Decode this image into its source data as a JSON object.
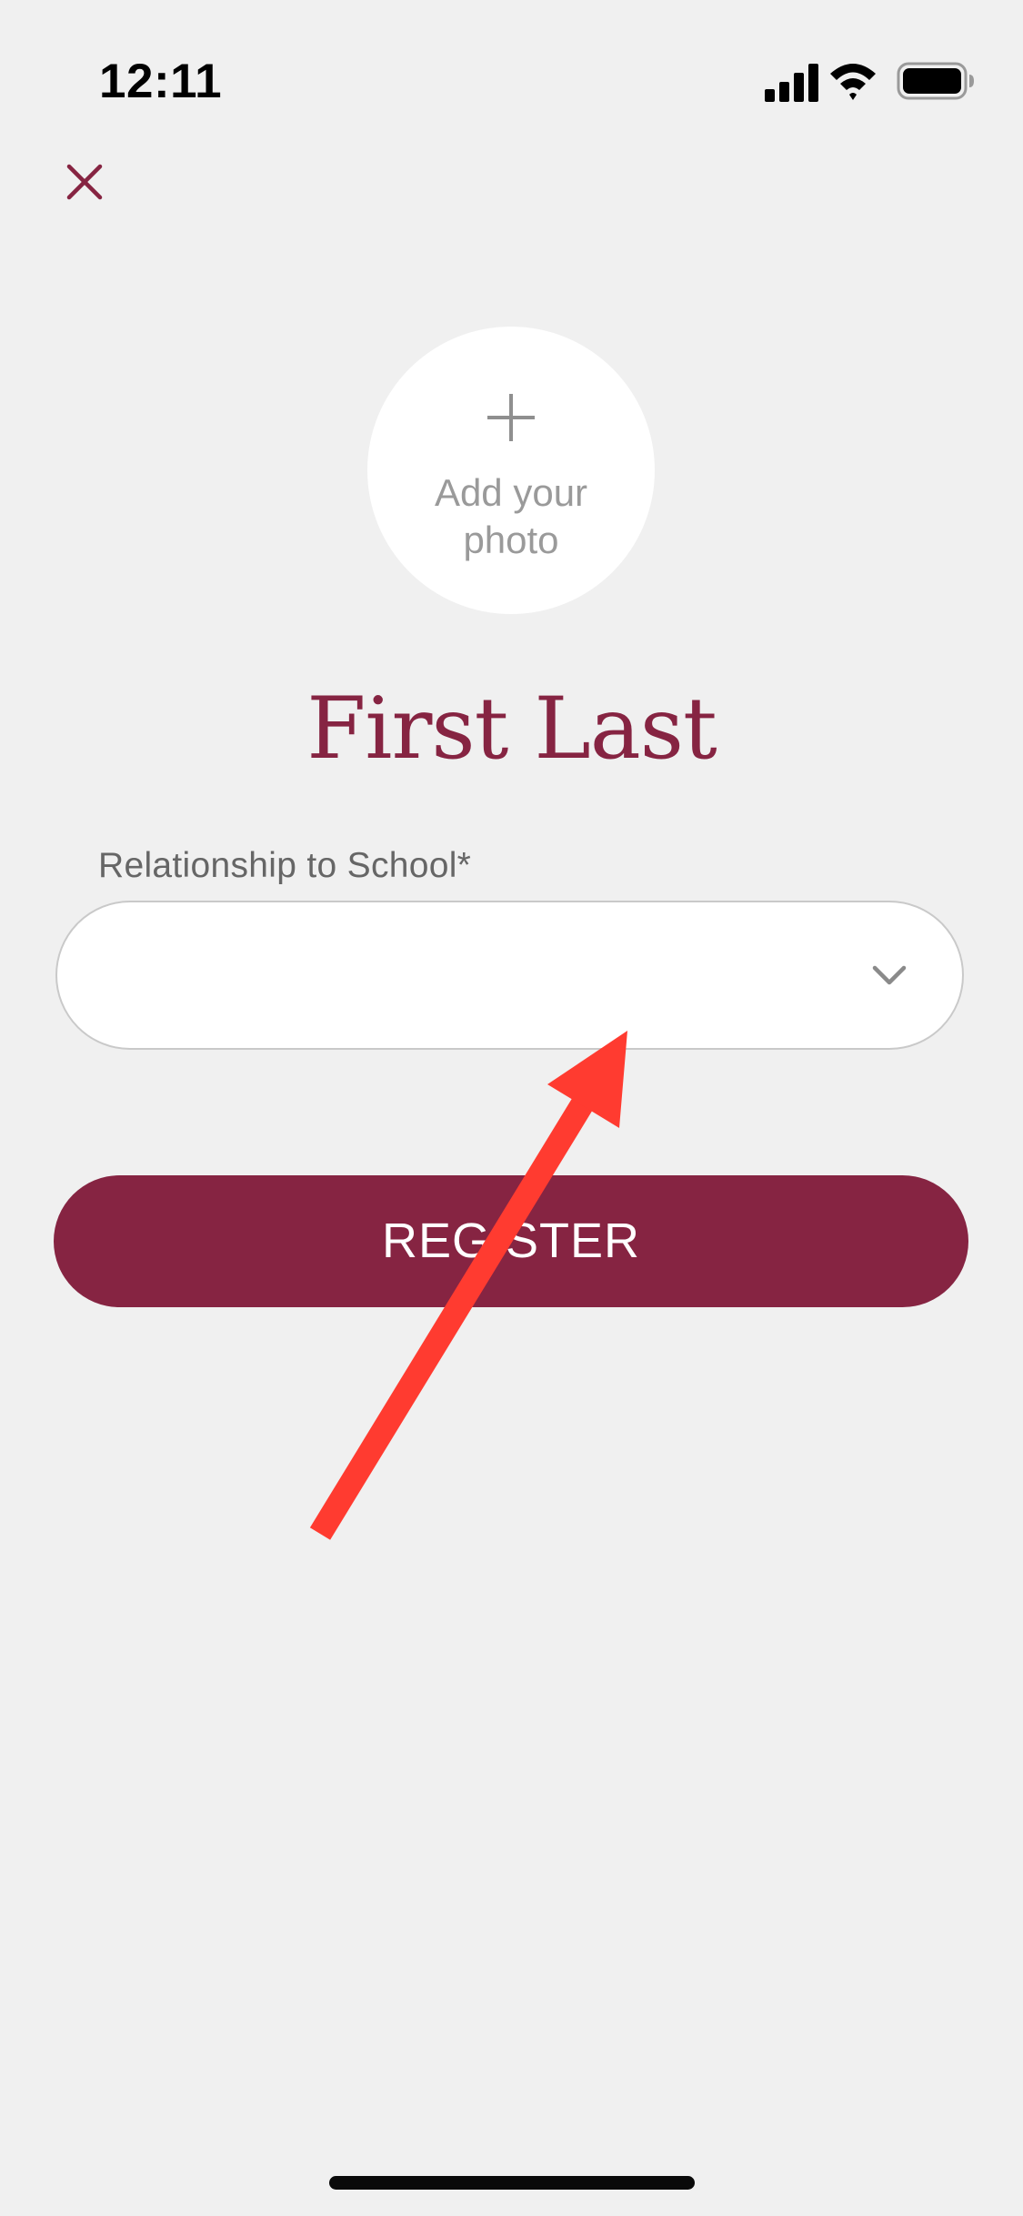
{
  "status_bar": {
    "time": "12:11",
    "icons": [
      "signal-icon",
      "wifi-icon",
      "battery-icon"
    ]
  },
  "header": {
    "close_icon": "close-icon"
  },
  "avatar": {
    "icon": "plus-icon",
    "label": "Add your photo"
  },
  "profile": {
    "name": "First Last"
  },
  "form": {
    "relationship_label": "Relationship to School*",
    "relationship_value": "",
    "dropdown_icon": "chevron-down-icon",
    "register_label": "REGISTER"
  },
  "annotation": {
    "icon": "arrow-annotation-icon",
    "color": "#ff3b30"
  },
  "colors": {
    "background": "#f0f0f0",
    "accent": "#862442",
    "placeholder_text": "#9a9a9a",
    "label_text": "#666666",
    "field_border": "#c9c9c9"
  }
}
